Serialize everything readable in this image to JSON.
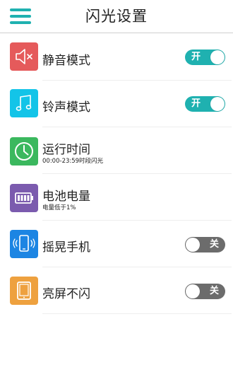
{
  "header": {
    "title": "闪光设置",
    "accent_color": "#1fb1b0"
  },
  "settings": [
    {
      "label": "静音模式",
      "icon": "speaker-mute-icon",
      "icon_color": "#e55a5b",
      "toggle": {
        "state": "on",
        "text": "开"
      }
    },
    {
      "label": "铃声模式",
      "icon": "music-note-icon",
      "icon_color": "#13c4e8",
      "toggle": {
        "state": "on",
        "text": "开"
      }
    },
    {
      "label": "运行时间",
      "sub": "00:00-23:59时段闪光",
      "icon": "clock-icon",
      "icon_color": "#3bb85e"
    },
    {
      "label": "电池电量",
      "sub": "电量低于1%",
      "icon": "battery-icon",
      "icon_color": "#7b5bae"
    },
    {
      "label": "摇晃手机",
      "icon": "phone-shake-icon",
      "icon_color": "#1c85e3",
      "toggle": {
        "state": "off",
        "text": "关"
      }
    },
    {
      "label": "亮屏不闪",
      "icon": "tablet-icon",
      "icon_color": "#eea13f",
      "toggle": {
        "state": "off",
        "text": "关"
      }
    }
  ],
  "colors": {
    "toggle_on": "#1fb1b0",
    "toggle_off": "#6c6c6c"
  }
}
